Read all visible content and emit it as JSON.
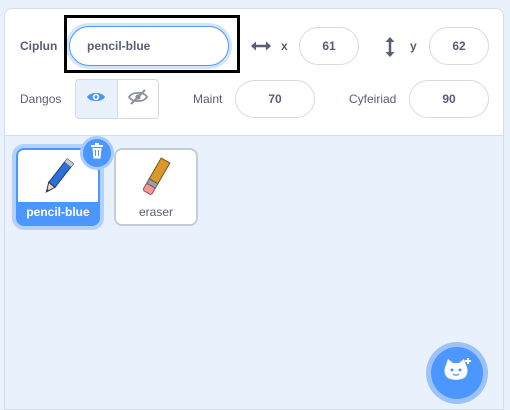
{
  "sprite_info": {
    "name_label": "Ciplun",
    "name_value": "pencil-blue",
    "x_label": "x",
    "x_value": "61",
    "y_label": "y",
    "y_value": "62",
    "show_label": "Dangos",
    "size_label": "Maint",
    "size_value": "70",
    "direction_label": "Cyfeiriad",
    "direction_value": "90",
    "visible": true
  },
  "sprites": [
    {
      "name": "pencil-blue",
      "selected": true
    },
    {
      "name": "eraser",
      "selected": false
    }
  ],
  "colors": {
    "accent": "#4c97ff",
    "text": "#575e75",
    "panel_bg": "#e9f1fc"
  },
  "icons": [
    "x-arrows-icon",
    "y-arrows-icon",
    "eye-icon",
    "eye-slash-icon",
    "trash-icon",
    "pencil-icon",
    "eraser-icon",
    "cat-add-icon"
  ]
}
